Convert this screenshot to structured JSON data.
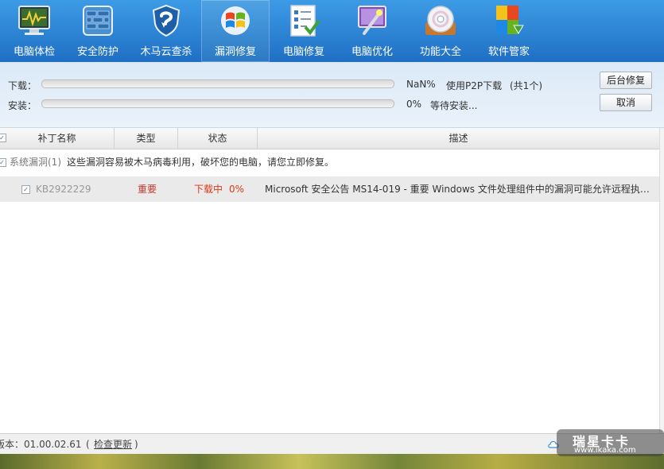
{
  "toolbar": {
    "items": [
      {
        "label": "电脑体检",
        "icon": "monitor-icon"
      },
      {
        "label": "安全防护",
        "icon": "firewall-icon"
      },
      {
        "label": "木马云查杀",
        "icon": "shield-icon"
      },
      {
        "label": "漏洞修复",
        "icon": "windows-icon"
      },
      {
        "label": "电脑修复",
        "icon": "checklist-icon"
      },
      {
        "label": "电脑优化",
        "icon": "magic-wand-icon"
      },
      {
        "label": "功能大全",
        "icon": "disc-icon"
      },
      {
        "label": "软件管家",
        "icon": "software-icon"
      }
    ],
    "active_index": 3
  },
  "progress": {
    "download_label": "下载：",
    "download_percent": "NaN%",
    "download_info": "使用P2P下载",
    "download_count": "(共1个)",
    "install_label": "安装：",
    "install_percent": "0%",
    "install_status": "等待安装...",
    "download_fill": 0,
    "install_fill": 0
  },
  "buttons": {
    "background_repair": "后台修复",
    "cancel": "取消"
  },
  "table": {
    "columns": [
      "补丁名称",
      "类型",
      "状态",
      "描述"
    ],
    "group": {
      "name": "系统漏洞(1)",
      "description": "这些漏洞容易被木马病毒利用，破坏您的电脑，请您立即修复。"
    },
    "rows": [
      {
        "patch": "KB2922229",
        "type": "重要",
        "status": "下载中",
        "status_percent": "0%",
        "description": "Microsoft 安全公告 MS14-019 - 重要 Windows 文件处理组件中的漏洞可能允许远程执行..."
      }
    ]
  },
  "footer": {
    "version": "版本：01.00.02.61",
    "check_update": "检查更新",
    "open_paren": "(",
    "close_paren": ")"
  },
  "watermark": {
    "title": "瑞星卡卡",
    "url": "www.ikaka.com"
  },
  "colors": {
    "toolbar_top": "#3d9be6",
    "toolbar_bottom": "#1f6fc4",
    "important": "#c0392b",
    "downloading": "#d9391a",
    "row_bg": "#eaeaea"
  }
}
